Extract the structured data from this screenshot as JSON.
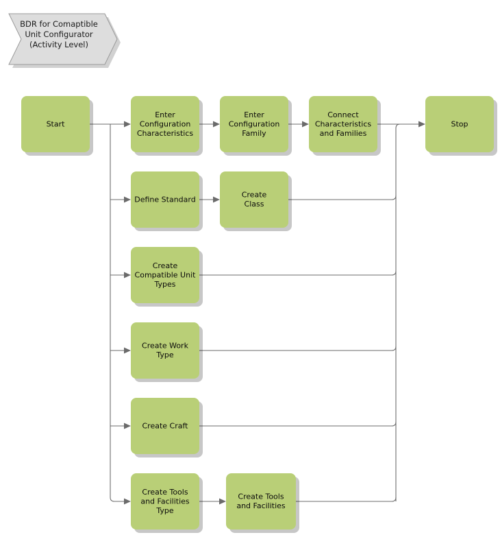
{
  "diagram": {
    "title_lines": [
      "BDR for Comaptible",
      "Unit Configurator",
      "(Activity Level)"
    ],
    "title_full": "BDR for Comaptible Unit Configurator (Activity Level)",
    "node_fill": "#b9cf77",
    "edge_color": "#6b6b6b",
    "banner_fill": "#dddddd",
    "banner_stroke": "#9a9a9a",
    "background": "#ffffff"
  },
  "nodes": {
    "start": {
      "label": "Start",
      "lines": [
        "Start"
      ]
    },
    "enter_configuration_characteristics": {
      "label": "Enter Configuration Characteristics",
      "lines": [
        "Enter",
        "Configuration",
        "Characteristics"
      ]
    },
    "enter_configuration_family": {
      "label": "Enter Configuration Family",
      "lines": [
        "Enter",
        "Configuration",
        "Family"
      ]
    },
    "connect_characteristics_and_families": {
      "label": "Connect Characteristics and Families",
      "lines": [
        "Connect",
        "Characteristics",
        "and Families"
      ]
    },
    "stop": {
      "label": "Stop",
      "lines": [
        "Stop"
      ]
    },
    "define_standard": {
      "label": "Define Standard",
      "lines": [
        "Define Standard"
      ]
    },
    "create_class": {
      "label": "Create Class",
      "lines": [
        "Create",
        "Class"
      ]
    },
    "create_compatible_unit_types": {
      "label": "Create Compatible Unit Types",
      "lines": [
        "Create",
        "Compatible Unit",
        "Types"
      ]
    },
    "create_work_type": {
      "label": "Create Work Type",
      "lines": [
        "Create Work",
        "Type"
      ]
    },
    "create_craft": {
      "label": "Create Craft",
      "lines": [
        "Create Craft"
      ]
    },
    "create_tools_and_facilities_type": {
      "label": "Create Tools and Facilities Type",
      "lines": [
        "Create Tools",
        "and Facilities",
        "Type"
      ]
    },
    "create_tools_and_facilities": {
      "label": "Create Tools and Facilities",
      "lines": [
        "Create Tools",
        "and Facilities"
      ]
    }
  }
}
